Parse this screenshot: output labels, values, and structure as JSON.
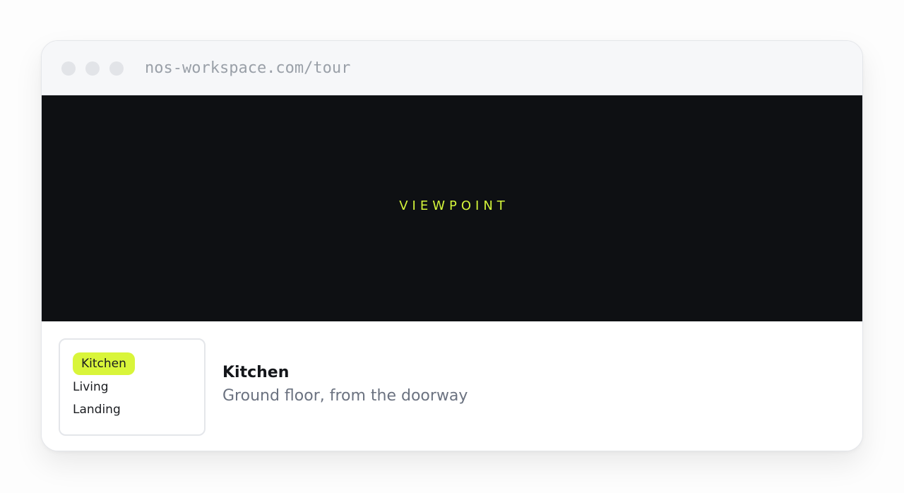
{
  "browser": {
    "url": "nos-workspace.com/tour"
  },
  "viewer": {
    "label": "VIEWPOINT"
  },
  "rooms": {
    "items": [
      {
        "label": "Kitchen",
        "active": true
      },
      {
        "label": "Living",
        "active": false
      },
      {
        "label": "Landing",
        "active": false
      }
    ]
  },
  "details": {
    "title": "Kitchen",
    "subtitle": "Ground floor, from the doorway"
  },
  "colors": {
    "accent": "#d9f53a",
    "viewer_bg": "#0e1013"
  }
}
